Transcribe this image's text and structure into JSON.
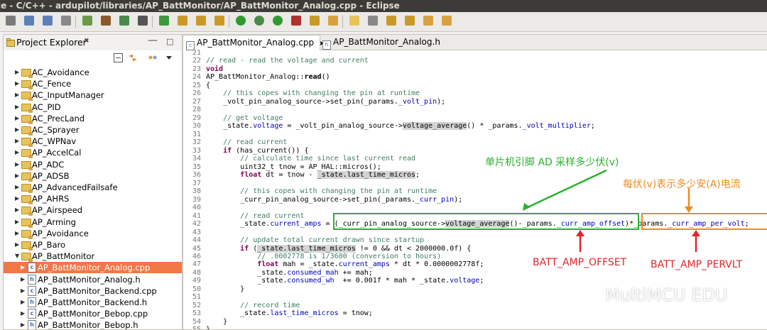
{
  "window": {
    "title": "ce - C/C++ - ardupilot/libraries/AP_BattMonitor/AP_BattMonitor_Analog.cpp - Eclipse"
  },
  "toolbar": {
    "icons": [
      "new-icon",
      "save-icon",
      "save-all-icon",
      "print-icon",
      "build-icon",
      "hammer-icon",
      "debug-config-icon",
      "terminal-icon",
      "refresh-icon",
      "new-folder-icon",
      "open-type-icon",
      "new-class-icon",
      "run-icon",
      "debug-icon",
      "run-external-icon",
      "coverage-icon",
      "search-icon",
      "annotation-icon",
      "mark-occurrences-icon",
      "show-whitespace-icon",
      "next-annotation-icon",
      "prev-annotation-icon",
      "back-icon",
      "forward-icon"
    ]
  },
  "project_explorer": {
    "title": "Project Explorer",
    "close_glyph": "✖",
    "items": [
      {
        "label": "AC_Avoidance",
        "type": "folder",
        "level": 1,
        "expanded": false,
        "selected": false
      },
      {
        "label": "AC_Fence",
        "type": "folder",
        "level": 1,
        "expanded": false,
        "selected": false
      },
      {
        "label": "AC_InputManager",
        "type": "folder",
        "level": 1,
        "expanded": false,
        "selected": false
      },
      {
        "label": "AC_PID",
        "type": "folder",
        "level": 1,
        "expanded": false,
        "selected": false
      },
      {
        "label": "AC_PrecLand",
        "type": "folder",
        "level": 1,
        "expanded": false,
        "selected": false
      },
      {
        "label": "AC_Sprayer",
        "type": "folder",
        "level": 1,
        "expanded": false,
        "selected": false
      },
      {
        "label": "AC_WPNav",
        "type": "folder",
        "level": 1,
        "expanded": false,
        "selected": false
      },
      {
        "label": "AP_AccelCal",
        "type": "folder",
        "level": 1,
        "expanded": false,
        "selected": false
      },
      {
        "label": "AP_ADC",
        "type": "folder",
        "level": 1,
        "expanded": false,
        "selected": false
      },
      {
        "label": "AP_ADSB",
        "type": "folder",
        "level": 1,
        "expanded": false,
        "selected": false
      },
      {
        "label": "AP_AdvancedFailsafe",
        "type": "folder",
        "level": 1,
        "expanded": false,
        "selected": false
      },
      {
        "label": "AP_AHRS",
        "type": "folder",
        "level": 1,
        "expanded": false,
        "selected": false
      },
      {
        "label": "AP_Airspeed",
        "type": "folder",
        "level": 1,
        "expanded": false,
        "selected": false
      },
      {
        "label": "AP_Arming",
        "type": "folder",
        "level": 1,
        "expanded": false,
        "selected": false
      },
      {
        "label": "AP_Avoidance",
        "type": "folder",
        "level": 1,
        "expanded": false,
        "selected": false
      },
      {
        "label": "AP_Baro",
        "type": "folder",
        "level": 1,
        "expanded": false,
        "selected": false
      },
      {
        "label": "AP_BattMonitor",
        "type": "folder",
        "level": 1,
        "expanded": true,
        "selected": false
      },
      {
        "label": "AP_BattMonitor_Analog.cpp",
        "type": "cpp",
        "level": 2,
        "expanded": false,
        "selected": true
      },
      {
        "label": "AP_BattMonitor_Analog.h",
        "type": "h",
        "level": 2,
        "expanded": false,
        "selected": false
      },
      {
        "label": "AP_BattMonitor_Backend.cpp",
        "type": "cpp",
        "level": 2,
        "expanded": false,
        "selected": false
      },
      {
        "label": "AP_BattMonitor_Backend.h",
        "type": "h",
        "level": 2,
        "expanded": false,
        "selected": false
      },
      {
        "label": "AP_BattMonitor_Bebop.cpp",
        "type": "cpp",
        "level": 2,
        "expanded": false,
        "selected": false
      },
      {
        "label": "AP_BattMonitor_Bebop.h",
        "type": "h",
        "level": 2,
        "expanded": false,
        "selected": false
      }
    ]
  },
  "editor": {
    "tabs": [
      {
        "label": "AP_BattMonitor_Analog.cpp",
        "icon": "c",
        "active": true,
        "close": "✖"
      },
      {
        "label": "AP_BattMonitor_Analog.h",
        "icon": "h",
        "active": false
      }
    ],
    "line_numbers": [
      "21",
      "22",
      "23",
      "24",
      "25",
      "26",
      "27",
      "28",
      "29",
      "30",
      "31",
      "32",
      "33",
      "34",
      "35",
      "36",
      "37",
      "38",
      "39",
      "40",
      "41",
      "42",
      "43",
      "44",
      "45",
      "46",
      "47",
      "48",
      "49",
      "50",
      "51",
      "52",
      "53",
      "54",
      "55"
    ],
    "lines": [
      [],
      [
        {
          "t": "// read - read the voltage and current",
          "c": "cm"
        }
      ],
      [
        {
          "t": "void",
          "c": "kw"
        }
      ],
      [
        {
          "t": "AP_BattMonitor_Analog::",
          "c": ""
        },
        {
          "t": "read",
          "c": "b"
        },
        {
          "t": "()",
          "c": ""
        }
      ],
      [
        {
          "t": "{",
          "c": ""
        }
      ],
      [
        {
          "t": "    // this copes with changing the pin at runtime",
          "c": "cm"
        }
      ],
      [
        {
          "t": "    _volt_pin_analog_source->set_pin(_params.",
          "c": ""
        },
        {
          "t": "_volt_pin",
          "c": "fld"
        },
        {
          "t": ");",
          "c": ""
        }
      ],
      [],
      [
        {
          "t": "    // get voltage",
          "c": "cm"
        }
      ],
      [
        {
          "t": "    _state.",
          "c": ""
        },
        {
          "t": "voltage",
          "c": "fld"
        },
        {
          "t": " = _volt_pin_analog_source->",
          "c": ""
        },
        {
          "t": "voltage_average",
          "c": "hl"
        },
        {
          "t": "() * _params.",
          "c": ""
        },
        {
          "t": "_volt_multiplier",
          "c": "fld"
        },
        {
          "t": ";",
          "c": ""
        }
      ],
      [],
      [
        {
          "t": "    // read current",
          "c": "cm"
        }
      ],
      [
        {
          "t": "    ",
          "c": ""
        },
        {
          "t": "if",
          "c": "kw"
        },
        {
          "t": " (has_current()) {",
          "c": ""
        }
      ],
      [
        {
          "t": "        // calculate time since last current read",
          "c": "cm"
        }
      ],
      [
        {
          "t": "        uint32_t tnow = AP_HAL::micros();",
          "c": ""
        }
      ],
      [
        {
          "t": "        ",
          "c": ""
        },
        {
          "t": "float",
          "c": "kw"
        },
        {
          "t": " dt = tnow - ",
          "c": ""
        },
        {
          "t": "_state.last_time_micros",
          "c": "hl"
        },
        {
          "t": ";",
          "c": ""
        }
      ],
      [],
      [
        {
          "t": "        // this copes with changing the pin at runtime",
          "c": "cm"
        }
      ],
      [
        {
          "t": "        _curr_pin_analog_source->set_pin(_params.",
          "c": ""
        },
        {
          "t": "_curr_pin",
          "c": "fld"
        },
        {
          "t": ");",
          "c": ""
        }
      ],
      [],
      [
        {
          "t": "        // read current",
          "c": "cm"
        }
      ],
      [
        {
          "t": "        _state.",
          "c": ""
        },
        {
          "t": "current_amps",
          "c": "fld"
        },
        {
          "t": " = (_curr_pin_analog_source->",
          "c": ""
        },
        {
          "t": "voltage_average",
          "c": "hl"
        },
        {
          "t": "()-_params.",
          "c": ""
        },
        {
          "t": "_curr_amp_offset",
          "c": "fld"
        },
        {
          "t": ")*_params.",
          "c": ""
        },
        {
          "t": "_curr_amp_per_volt",
          "c": "fld"
        },
        {
          "t": ";",
          "c": ""
        }
      ],
      [],
      [
        {
          "t": "        // update total current drawn since startup",
          "c": "cm"
        }
      ],
      [
        {
          "t": "        ",
          "c": ""
        },
        {
          "t": "if",
          "c": "kw"
        },
        {
          "t": " (",
          "c": ""
        },
        {
          "t": "_state.last_time_micros",
          "c": "hl"
        },
        {
          "t": " != 0 && dt < 2000000.0f) {",
          "c": ""
        }
      ],
      [
        {
          "t": "            // .0002778 is 1/3600 (conversion to hours)",
          "c": "cm"
        }
      ],
      [
        {
          "t": "            ",
          "c": ""
        },
        {
          "t": "float",
          "c": "kw"
        },
        {
          "t": " mah = _state.",
          "c": ""
        },
        {
          "t": "current_amps",
          "c": "fld"
        },
        {
          "t": " * dt * 0.0000002778f;",
          "c": ""
        }
      ],
      [
        {
          "t": "            _state.",
          "c": ""
        },
        {
          "t": "consumed_mah",
          "c": "fld"
        },
        {
          "t": " += mah;",
          "c": ""
        }
      ],
      [
        {
          "t": "            _state.",
          "c": ""
        },
        {
          "t": "consumed_wh",
          "c": "fld"
        },
        {
          "t": "  += 0.001f * mah * _state.",
          "c": ""
        },
        {
          "t": "voltage",
          "c": "fld"
        },
        {
          "t": ";",
          "c": ""
        }
      ],
      [
        {
          "t": "        }",
          "c": ""
        }
      ],
      [],
      [
        {
          "t": "        // record time",
          "c": "cm"
        }
      ],
      [
        {
          "t": "        _state.",
          "c": ""
        },
        {
          "t": "last_time_micros",
          "c": "fld"
        },
        {
          "t": " = tnow;",
          "c": ""
        }
      ],
      [
        {
          "t": "    }",
          "c": ""
        }
      ],
      [
        {
          "t": "}",
          "c": ""
        }
      ]
    ]
  },
  "annotations": {
    "green_label": "单片机引脚 AD 采样多少伏(v)",
    "orange_label": "每伏(v)表示多少安(A)电流",
    "offset_label": "BATT_AMP_OFFSET",
    "pervlt_label": "BATT_AMP_PERVLT",
    "colors": {
      "green": "#2ab12f",
      "orange": "#f08a23",
      "red": "#e3242b"
    }
  },
  "watermark": {
    "text": "MultiMCU EDU"
  }
}
